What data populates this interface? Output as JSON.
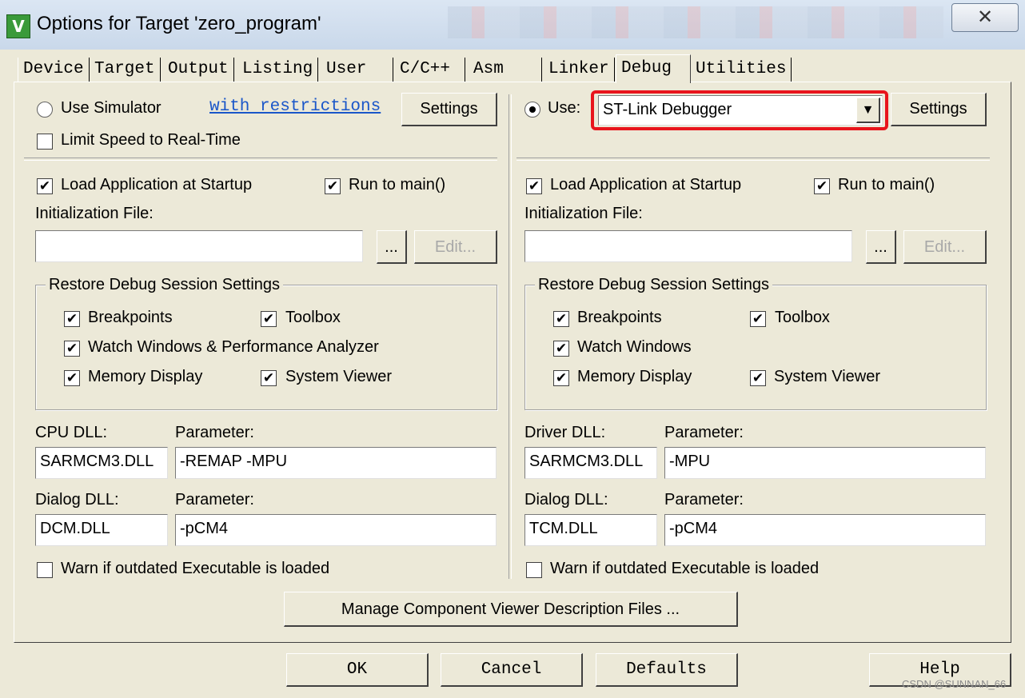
{
  "window": {
    "title": "Options for Target 'zero_program'",
    "icon_letter": "V",
    "close_symbol": "✕"
  },
  "tabs": [
    "Device",
    "Target",
    "Output",
    "Listing",
    "User",
    "C/C++",
    "Asm",
    "Linker",
    "Debug",
    "Utilities"
  ],
  "active_tab": "Debug",
  "left": {
    "use_simulator_label": "Use Simulator",
    "restrictions_link": "with restrictions",
    "settings_label": "Settings",
    "limit_speed_label": "Limit Speed to Real-Time",
    "load_app_label": "Load Application at Startup",
    "run_main_label": "Run to main()",
    "init_file_label": "Initialization File:",
    "init_file_value": "",
    "browse_label": "...",
    "edit_label": "Edit...",
    "restore_title": "Restore Debug Session Settings",
    "breakpoints_label": "Breakpoints",
    "toolbox_label": "Toolbox",
    "watch_label": "Watch Windows & Performance Analyzer",
    "memory_label": "Memory Display",
    "sysviewer_label": "System Viewer",
    "dll_label": "CPU DLL:",
    "dll_param_label": "Parameter:",
    "dll_value": "SARMCM3.DLL",
    "dll_param_value": "-REMAP -MPU",
    "dialog_dll_label": "Dialog DLL:",
    "dialog_param_label": "Parameter:",
    "dialog_dll_value": "DCM.DLL",
    "dialog_param_value": "-pCM4",
    "warn_label": "Warn if outdated Executable is loaded"
  },
  "right": {
    "use_label": "Use:",
    "debugger_value": "ST-Link Debugger",
    "settings_label": "Settings",
    "load_app_label": "Load Application at Startup",
    "run_main_label": "Run to main()",
    "init_file_label": "Initialization File:",
    "init_file_value": "",
    "browse_label": "...",
    "edit_label": "Edit...",
    "restore_title": "Restore Debug Session Settings",
    "breakpoints_label": "Breakpoints",
    "toolbox_label": "Toolbox",
    "watch_label": "Watch Windows",
    "memory_label": "Memory Display",
    "sysviewer_label": "System Viewer",
    "dll_label": "Driver DLL:",
    "dll_param_label": "Parameter:",
    "dll_value": "SARMCM3.DLL",
    "dll_param_value": "-MPU",
    "dialog_dll_label": "Dialog DLL:",
    "dialog_param_label": "Parameter:",
    "dialog_dll_value": "TCM.DLL",
    "dialog_param_value": "-pCM4",
    "warn_label": "Warn if outdated Executable is loaded"
  },
  "manage_label": "Manage Component Viewer Description Files ...",
  "footer": {
    "ok": "OK",
    "cancel": "Cancel",
    "defaults": "Defaults",
    "help": "Help"
  },
  "watermark": "CSDN @SUNNAN_66",
  "check_mark": "✔",
  "colors": {
    "highlight": "#e8141c",
    "link": "#1a56c9",
    "dialog_bg": "#ece9d8"
  }
}
